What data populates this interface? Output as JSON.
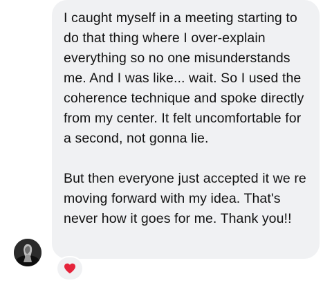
{
  "message": {
    "paragraphs": [
      "I caught myself in a meeting starting to do that thing where I over-explain everything so no one misunderstands me. And I was like... wait. So I used the coherence technique and spoke directly from my center. It felt uncomfortable for a second, not gonna lie.",
      "But then everyone just accepted it we re moving forward with my idea. That's never how it goes for me. Thank you!!"
    ],
    "reaction": {
      "icon": "heart-icon",
      "color": "#e5243b"
    },
    "bubble_color": "#f0f1f3"
  },
  "sender": {
    "avatar_icon": "avatar"
  }
}
